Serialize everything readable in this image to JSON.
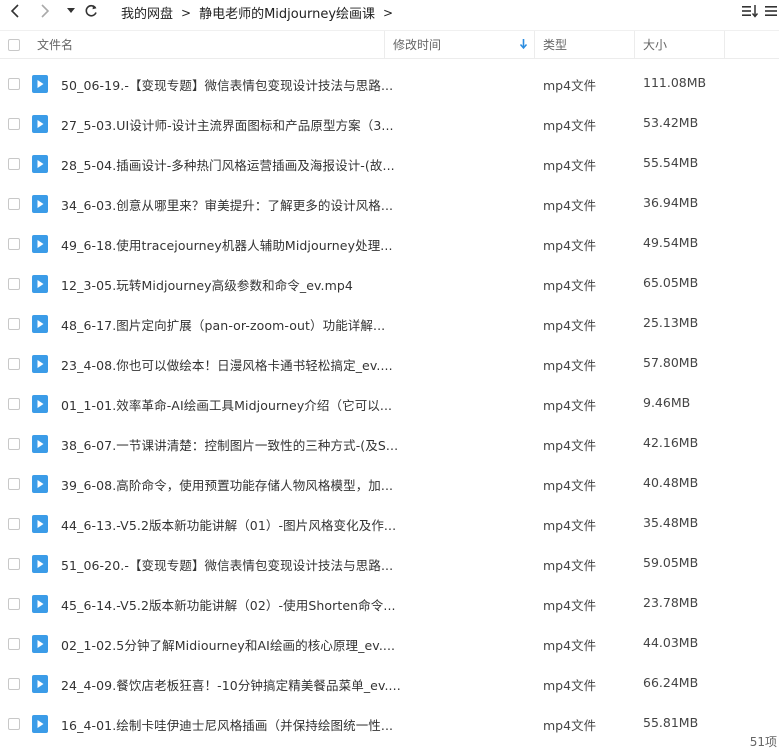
{
  "nav": {
    "back_icon": "chevron-left-icon",
    "forward_icon": "chevron-right-icon",
    "dropdown_icon": "caret-down-icon",
    "refresh_icon": "refresh-icon"
  },
  "breadcrumb": {
    "items": [
      "我的网盘",
      "静电老师的Midjourney绘画课"
    ],
    "separator": ">"
  },
  "toolbar_right": {
    "sort_icon": "sort-icon",
    "list_view_icon": "list-view-icon"
  },
  "columns": {
    "name": "文件名",
    "modified": "修改时间",
    "type": "类型",
    "size": "大小",
    "sort_arrow_icon": "arrow-down-icon"
  },
  "colors": {
    "icon_blue": "#3b9ce8",
    "sort_arrow": "#2b8de0"
  },
  "files": [
    {
      "name": "50_06-19.-【变现专题】微信表情包变现设计技法与思路...",
      "type": "mp4文件",
      "size": "111.08MB"
    },
    {
      "name": "27_5-03.UI设计师-设计主流界面图标和产品原型方案（3...",
      "type": "mp4文件",
      "size": "53.42MB"
    },
    {
      "name": "28_5-04.插画设计-多种热门风格运营插画及海报设计-(故...",
      "type": "mp4文件",
      "size": "55.54MB"
    },
    {
      "name": "34_6-03.创意从哪里来？审美提升：了解更多的设计风格...",
      "type": "mp4文件",
      "size": "36.94MB"
    },
    {
      "name": "49_6-18.使用tracejourney机器人辅助Midjourney处理...",
      "type": "mp4文件",
      "size": "49.54MB"
    },
    {
      "name": "12_3-05.玩转Midjourney高级参数和命令_ev.mp4",
      "type": "mp4文件",
      "size": "65.05MB"
    },
    {
      "name": "48_6-17.图片定向扩展（pan-or-zoom-out）功能详解...",
      "type": "mp4文件",
      "size": "25.13MB"
    },
    {
      "name": "23_4-08.你也可以做绘本！日漫风格卡通书轻松搞定_ev....",
      "type": "mp4文件",
      "size": "57.80MB"
    },
    {
      "name": "01_1-01.效率革命-AI绘画工具Midjourney介绍（它可以...",
      "type": "mp4文件",
      "size": "9.46MB"
    },
    {
      "name": "38_6-07.一节课讲清楚：控制图片一致性的三种方式-(及S...",
      "type": "mp4文件",
      "size": "42.16MB"
    },
    {
      "name": "39_6-08.高阶命令，使用预置功能存储人物风格模型，加...",
      "type": "mp4文件",
      "size": "40.48MB"
    },
    {
      "name": "44_6-13.-V5.2版本新功能讲解（01）-图片风格变化及作...",
      "type": "mp4文件",
      "size": "35.48MB"
    },
    {
      "name": "51_06-20.-【变现专题】微信表情包变现设计技法与思路...",
      "type": "mp4文件",
      "size": "59.05MB"
    },
    {
      "name": "45_6-14.-V5.2版本新功能讲解（02）-使用Shorten命令...",
      "type": "mp4文件",
      "size": "23.78MB"
    },
    {
      "name": "02_1-02.5分钟了解Midiourney和AI绘画的核心原理_ev....",
      "type": "mp4文件",
      "size": "44.03MB"
    },
    {
      "name": "24_4-09.餐饮店老板狂喜！-10分钟搞定精美餐品菜单_ev....",
      "type": "mp4文件",
      "size": "66.24MB"
    },
    {
      "name": "16_4-01.绘制卡哇伊迪士尼风格插画（并保持绘图统一性...",
      "type": "mp4文件",
      "size": "55.81MB"
    }
  ],
  "status": {
    "count": "51项"
  }
}
